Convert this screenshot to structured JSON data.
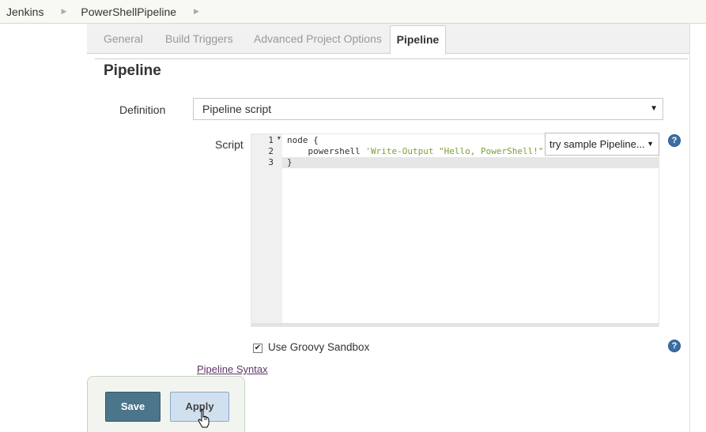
{
  "breadcrumb": {
    "items": [
      "Jenkins",
      "PowerShellPipeline"
    ]
  },
  "tabs": [
    {
      "label": "General"
    },
    {
      "label": "Build Triggers"
    },
    {
      "label": "Advanced Project Options"
    },
    {
      "label": "Pipeline"
    }
  ],
  "section": {
    "title": "Pipeline"
  },
  "definition": {
    "label": "Definition",
    "value": "Pipeline script"
  },
  "script": {
    "label": "Script",
    "line_numbers": [
      "1",
      "2",
      "3"
    ],
    "lines": [
      {
        "code": "node {"
      },
      {
        "code_prefix": "    powershell ",
        "code_string": "'Write-Output \"Hello, PowerShell!\"'"
      },
      {
        "code": "}"
      }
    ],
    "sample_select": "try sample Pipeline..."
  },
  "sandbox": {
    "label": "Use Groovy Sandbox",
    "checked": true
  },
  "pipeline_syntax_link": "Pipeline Syntax",
  "buttons": {
    "save": "Save",
    "apply": "Apply"
  },
  "help_glyph": "?",
  "icons": [
    "chevron-right-icon",
    "dropdown-arrow-icon",
    "help-icon",
    "checkbox-icon",
    "hand-cursor-icon"
  ]
}
